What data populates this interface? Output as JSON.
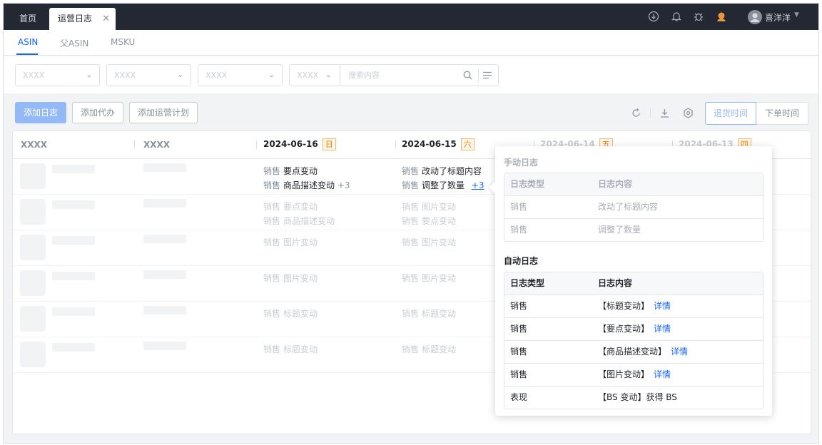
{
  "topbar": {
    "tabs": [
      {
        "label": "首页"
      },
      {
        "label": "运营日志"
      }
    ],
    "user": {
      "name": "喜洋洋"
    }
  },
  "subnav": {
    "tabs": [
      {
        "label": "ASIN",
        "active": true
      },
      {
        "label": "父ASIN"
      },
      {
        "label": "MSKU"
      }
    ]
  },
  "filters": {
    "select1": "XXXX",
    "select2": "XXXX",
    "select3": "XXXX",
    "search_type": "XXXX",
    "search_placeholder": "搜索内容"
  },
  "actions": {
    "add_log": "添加日志",
    "add_todo": "添加代办",
    "add_plan": "添加运营计划",
    "time_toggle": [
      "退货时间",
      "下单时间"
    ]
  },
  "table": {
    "columns": [
      {
        "label": "XXXX"
      },
      {
        "label": "XXXX"
      },
      {
        "label": "2024-06-16",
        "badge": "日"
      },
      {
        "label": "2024-06-15",
        "badge": "六"
      },
      {
        "label": "2024-06-14",
        "badge": "五"
      },
      {
        "label": "2024-06-13",
        "badge": "四"
      }
    ],
    "rows": [
      {
        "d16": [
          {
            "cat": "销售",
            "text": "要点变动"
          },
          {
            "cat": "销售",
            "text": "商品描述变动",
            "more": "+3"
          }
        ],
        "d15": [
          {
            "cat": "销售",
            "text": "改动了标题内容"
          },
          {
            "cat": "销售",
            "text": "调整了数量",
            "more": "+3"
          }
        ]
      },
      {
        "d16": [
          {
            "cat": "销售",
            "text": "要点变动"
          },
          {
            "cat": "销售",
            "text": "商品描述变动"
          }
        ],
        "d15": [
          {
            "cat": "销售",
            "text": "图片变动"
          },
          {
            "cat": "销售",
            "text": "要点变动"
          }
        ]
      },
      {
        "d16": [
          {
            "cat": "销售",
            "text": "图片变动"
          }
        ],
        "d15": [
          {
            "cat": "销售",
            "text": "图片变动"
          }
        ]
      },
      {
        "d16": [
          {
            "cat": "销售",
            "text": "图片变动"
          }
        ],
        "d15": [
          {
            "cat": "销售",
            "text": "图片变动"
          }
        ]
      },
      {
        "d16": [
          {
            "cat": "销售",
            "text": "标题变动"
          }
        ],
        "d15": [
          {
            "cat": "销售",
            "text": "标题变动"
          }
        ]
      },
      {
        "d16": [
          {
            "cat": "销售",
            "text": "标题变动"
          }
        ],
        "d15": [
          {
            "cat": "销售",
            "text": "标题变动"
          }
        ]
      }
    ]
  },
  "popover": {
    "manual": {
      "title": "手动日志",
      "headers": [
        "日志类型",
        "日志内容"
      ],
      "rows": [
        {
          "type": "销售",
          "content": "改动了标题内容"
        },
        {
          "type": "销售",
          "content": "调整了数量"
        }
      ]
    },
    "auto": {
      "title": "自动日志",
      "headers": [
        "日志类型",
        "日志内容"
      ],
      "rows": [
        {
          "type": "销售",
          "content": "【标题变动】",
          "link": "详情"
        },
        {
          "type": "销售",
          "content": "【要点变动】",
          "link": "详情"
        },
        {
          "type": "销售",
          "content": "【商品描述变动】",
          "link": "详情"
        },
        {
          "type": "销售",
          "content": "【图片变动】",
          "link": "详情"
        },
        {
          "type": "表现",
          "content": "【BS 变动】获得 BS"
        }
      ]
    }
  }
}
